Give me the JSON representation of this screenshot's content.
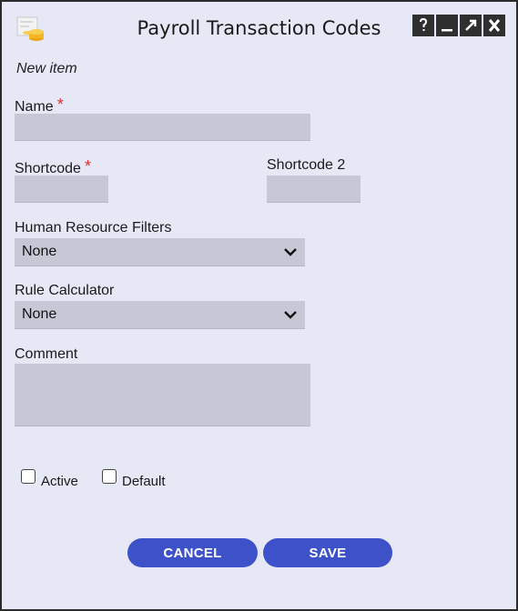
{
  "window": {
    "title": "Payroll Transaction Codes",
    "controls": [
      "help-icon",
      "minimize-icon",
      "maximize-icon",
      "close-icon"
    ]
  },
  "form": {
    "mode_label": "New item",
    "name": {
      "label": "Name",
      "required": "*",
      "value": ""
    },
    "shortcode": {
      "label": "Shortcode",
      "required": "*",
      "value": ""
    },
    "shortcode2": {
      "label": "Shortcode 2",
      "value": ""
    },
    "hr_filters": {
      "label": "Human Resource Filters",
      "selected": "None"
    },
    "rule_calculator": {
      "label": "Rule Calculator",
      "selected": "None"
    },
    "comment": {
      "label": "Comment",
      "value": ""
    },
    "active": {
      "label": "Active",
      "checked": false
    },
    "default": {
      "label": "Default",
      "checked": false
    }
  },
  "actions": {
    "cancel": "CANCEL",
    "save": "SAVE"
  },
  "colors": {
    "background": "#e7e8f6",
    "field": "#c7c8d6",
    "button": "#3d52c8",
    "required": "#e0302d"
  }
}
